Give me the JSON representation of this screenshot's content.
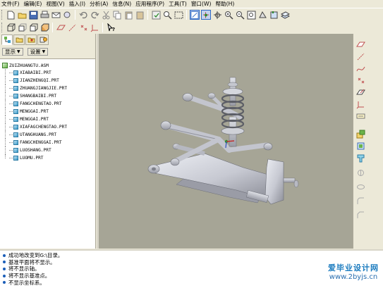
{
  "menu": [
    "文件(F)",
    "编辑(E)",
    "视图(V)",
    "插入(I)",
    "分析(A)",
    "信息(N)",
    "应用程序(P)",
    "工具(T)",
    "窗口(W)",
    "帮助(H)"
  ],
  "left_panel": {
    "show_button": "显示",
    "settings_button": "设置",
    "tree": {
      "root": "ZUIZHUANGTU.ASM",
      "items": [
        "XIABAIBI.PRT",
        "JIANZHENGQI.PRT",
        "ZHUANGJIANGJIE.PRT",
        "SHANGBAIBI.PRT",
        "FANGCHENGTAO.PRT",
        "MENGGAI.PRT",
        "MENGGAI.PRT",
        "XIAFAGCHENGTAO.PRT",
        "UTANGHUANG.PRT",
        "FANGCHENGGAI.PRT",
        "LUOSHANG.PRT",
        "LUOMU.PRT"
      ]
    }
  },
  "messages": [
    "成功地改变到G:\\目录。",
    "基准平面将不显示。",
    "将不显示轴。",
    "将不显示基准点。",
    "不显示坐标系。"
  ],
  "watermark": {
    "title": "爱毕业设计网",
    "url": "www.2byjs.cn"
  },
  "colors": {
    "background": "#a6a596",
    "part": "#d2d4dc",
    "accent": "#316ac5"
  }
}
